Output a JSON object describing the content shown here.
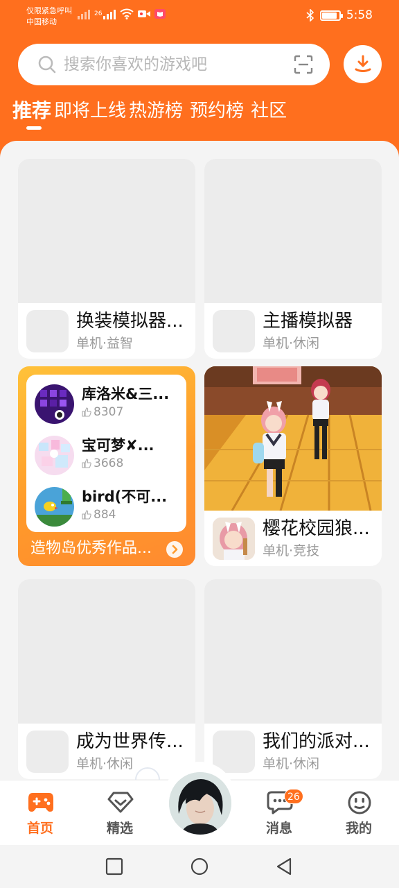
{
  "status_bar": {
    "emergency_text": "仅限紧急呼叫",
    "carrier": "中国移动",
    "signal_label": "26",
    "time": "5:58",
    "battery_level": 0.8
  },
  "search": {
    "placeholder": "搜索你喜欢的游戏吧"
  },
  "tabs": [
    {
      "label": "推荐",
      "active": true
    },
    {
      "label": "即将上线",
      "active": false
    },
    {
      "label": "热游榜",
      "active": false
    },
    {
      "label": "预约榜",
      "active": false
    },
    {
      "label": "社区",
      "active": false
    }
  ],
  "games": [
    {
      "title": "换装模拟器...",
      "tags": "单机·益智"
    },
    {
      "title": "主播模拟器",
      "tags": "单机·休闲"
    },
    {
      "title": "樱花校园狼...",
      "tags": "单机·竞技"
    },
    {
      "title": "成为世界传...",
      "tags": "单机·休闲"
    },
    {
      "title": "我们的派对...",
      "tags": "单机·休闲"
    }
  ],
  "promo": {
    "items": [
      {
        "name": "库洛米&三...",
        "likes": "8307"
      },
      {
        "name": "宝可梦✘...",
        "likes": "3668"
      },
      {
        "name": "bird(不可...",
        "likes": "884"
      }
    ],
    "footer": "造物岛优秀作品..."
  },
  "bottom_nav": [
    {
      "label": "首页",
      "icon": "gamepad-icon",
      "active": true
    },
    {
      "label": "精选",
      "icon": "heart-diamond-icon",
      "active": false
    },
    {
      "label": "消息",
      "icon": "chat-bubble-icon",
      "active": false
    },
    {
      "label": "我的",
      "icon": "smiley-icon",
      "active": false
    }
  ],
  "messages_badge": "26",
  "colors": {
    "accent": "#ff6f1e",
    "card_placeholder": "#ececec"
  }
}
